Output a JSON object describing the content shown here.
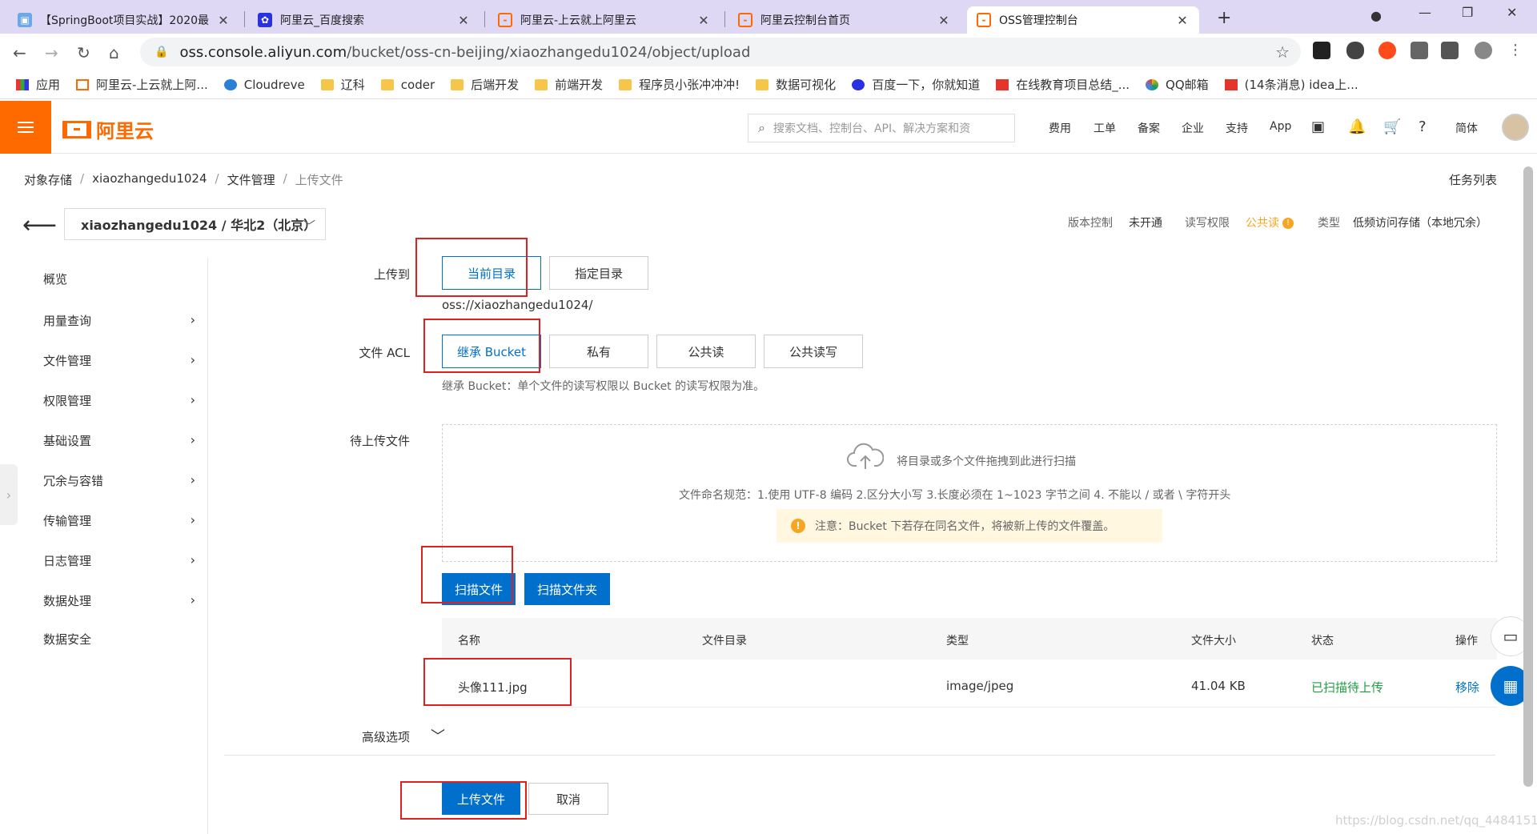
{
  "browser": {
    "tabs": [
      {
        "title": "【SpringBoot项目实战】2020最",
        "icon": "bilibili-icon",
        "color": "#6aa8e8"
      },
      {
        "title": "阿里云_百度搜索",
        "icon": "baidu-icon",
        "color": "#2932e1"
      },
      {
        "title": "阿里云-上云就上阿里云",
        "icon": "aliyun-icon",
        "color": "#ff6a00"
      },
      {
        "title": "阿里云控制台首页",
        "icon": "aliyun-icon",
        "color": "#ff6a00"
      },
      {
        "title": "OSS管理控制台",
        "icon": "aliyun-icon",
        "color": "#ff6a00"
      }
    ],
    "url_host": "oss.console.aliyun.com",
    "url_path": "/bucket/oss-cn-beijing/xiaozhangedu1024/object/upload",
    "bookmarks": [
      {
        "label": "应用",
        "icon": "apps-icon"
      },
      {
        "label": "阿里云-上云就上阿...",
        "icon": "aliyun-icon"
      },
      {
        "label": "Cloudreve",
        "icon": "cloud-icon"
      },
      {
        "label": "辽科",
        "icon": "folder-icon"
      },
      {
        "label": "coder",
        "icon": "folder-icon"
      },
      {
        "label": "后端开发",
        "icon": "folder-icon"
      },
      {
        "label": "前端开发",
        "icon": "folder-icon"
      },
      {
        "label": "程序员小张冲冲冲!",
        "icon": "folder-icon"
      },
      {
        "label": "数据可视化",
        "icon": "folder-icon"
      },
      {
        "label": "百度一下，你就知道",
        "icon": "baidu-icon"
      },
      {
        "label": "在线教育项目总结_...",
        "icon": "csdn-icon"
      },
      {
        "label": "QQ邮箱",
        "icon": "qqmail-icon"
      },
      {
        "label": "(14条消息) idea上...",
        "icon": "csdn-icon"
      }
    ]
  },
  "header": {
    "logo_text": "阿里云",
    "search_placeholder": "搜索文档、控制台、API、解决方案和资",
    "nav": [
      "费用",
      "工单",
      "备案",
      "企业",
      "支持",
      "App"
    ],
    "lang": "简体",
    "accent": "#ff6a00"
  },
  "breadcrumb": [
    "对象存储",
    "xiaozhangedu1024",
    "文件管理",
    "上传文件"
  ],
  "task_list": "任务列表",
  "bucket_selector": "xiaozhangedu1024 / 华北2（北京）",
  "meta": {
    "version_label": "版本控制",
    "version_value": "未开通",
    "acl_label": "读写权限",
    "acl_value": "公共读",
    "type_label": "类型",
    "type_value": "低频访问存储（本地冗余）"
  },
  "sidebar": [
    {
      "label": "概览",
      "has_chevron": false
    },
    {
      "label": "用量查询",
      "has_chevron": true
    },
    {
      "label": "文件管理",
      "has_chevron": true
    },
    {
      "label": "权限管理",
      "has_chevron": true
    },
    {
      "label": "基础设置",
      "has_chevron": true
    },
    {
      "label": "冗余与容错",
      "has_chevron": true
    },
    {
      "label": "传输管理",
      "has_chevron": true
    },
    {
      "label": "日志管理",
      "has_chevron": true
    },
    {
      "label": "数据处理",
      "has_chevron": true
    },
    {
      "label": "数据安全",
      "has_chevron": false
    }
  ],
  "form": {
    "upload_to_label": "上传到",
    "upload_to_options": [
      "当前目录",
      "指定目录"
    ],
    "upload_to_selected": "当前目录",
    "path": "oss://xiaozhangedu1024/",
    "acl_label": "文件 ACL",
    "acl_options": [
      "继承 Bucket",
      "私有",
      "公共读",
      "公共读写"
    ],
    "acl_selected": "继承 Bucket",
    "acl_hint": "继承 Bucket：单个文件的读写权限以 Bucket 的读写权限为准。",
    "pending_label": "待上传文件",
    "drop_text": "将目录或多个文件拖拽到此进行扫描",
    "naming_rule": "文件命名规范：1.使用 UTF-8 编码 2.区分大小写 3.长度必须在 1~1023 字节之间 4. 不能以 / 或者 \\ 字符开头",
    "notice": "注意：Bucket 下若存在同名文件，将被新上传的文件覆盖。",
    "scan_file": "扫描文件",
    "scan_folder": "扫描文件夹",
    "advanced": "高级选项",
    "submit": "上传文件",
    "cancel": "取消"
  },
  "table": {
    "columns": [
      "名称",
      "文件目录",
      "类型",
      "文件大小",
      "状态",
      "操作"
    ],
    "rows": [
      {
        "name": "头像111.jpg",
        "dir": "",
        "type": "image/jpeg",
        "size": "41.04 KB",
        "status": "已扫描待上传",
        "action": "移除"
      }
    ]
  },
  "watermark": "https://blog.csdn.net/qq_44841517"
}
